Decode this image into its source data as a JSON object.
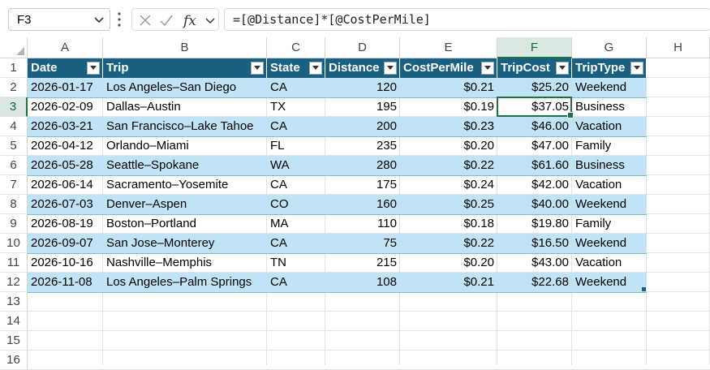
{
  "formula_bar": {
    "name_box": "F3",
    "formula": "=[@Distance]*[@CostPerMile]"
  },
  "columns": [
    "A",
    "B",
    "C",
    "D",
    "E",
    "F",
    "G",
    "H"
  ],
  "row_numbers": [
    "1",
    "2",
    "3",
    "4",
    "5",
    "6",
    "7",
    "8",
    "9",
    "10",
    "11",
    "12",
    "13",
    "14",
    "15",
    "16"
  ],
  "selected_cell": {
    "column": "F",
    "row": "3"
  },
  "table": {
    "headers": [
      "Date",
      "Trip",
      "State",
      "Distance",
      "CostPerMile",
      "TripCost",
      "TripType"
    ],
    "rows": [
      [
        "2026-01-17",
        "Los Angeles–San Diego",
        "CA",
        "120",
        "$0.21",
        "$25.20",
        "Weekend"
      ],
      [
        "2026-02-09",
        "Dallas–Austin",
        "TX",
        "195",
        "$0.19",
        "$37.05",
        "Business"
      ],
      [
        "2026-03-21",
        "San Francisco–Lake Tahoe",
        "CA",
        "200",
        "$0.23",
        "$46.00",
        "Vacation"
      ],
      [
        "2026-04-12",
        "Orlando–Miami",
        "FL",
        "235",
        "$0.20",
        "$47.00",
        "Family"
      ],
      [
        "2026-05-28",
        "Seattle–Spokane",
        "WA",
        "280",
        "$0.22",
        "$61.60",
        "Business"
      ],
      [
        "2026-06-14",
        "Sacramento–Yosemite",
        "CA",
        "175",
        "$0.24",
        "$42.00",
        "Vacation"
      ],
      [
        "2026-07-03",
        "Denver–Aspen",
        "CO",
        "160",
        "$0.25",
        "$40.00",
        "Weekend"
      ],
      [
        "2026-08-19",
        "Boston–Portland",
        "MA",
        "110",
        "$0.18",
        "$19.80",
        "Family"
      ],
      [
        "2026-09-07",
        "San Jose–Monterey",
        "CA",
        "75",
        "$0.22",
        "$16.50",
        "Weekend"
      ],
      [
        "2026-10-16",
        "Nashville–Memphis",
        "TN",
        "215",
        "$0.20",
        "$43.00",
        "Vacation"
      ],
      [
        "2026-11-08",
        "Los Angeles–Palm Springs",
        "CA",
        "108",
        "$0.21",
        "$22.68",
        "Weekend"
      ]
    ]
  },
  "colors": {
    "header_fill": "#196181",
    "band_fill": "#c0e4f5",
    "selection": "#1f7244"
  },
  "icons": {
    "name_box_dropdown": "chevron-down-icon",
    "more": "vertical-dots-icon",
    "cancel": "x-icon",
    "enter": "check-icon",
    "insert_function": "fx-icon",
    "filter": "filter-dropdown-icon"
  }
}
